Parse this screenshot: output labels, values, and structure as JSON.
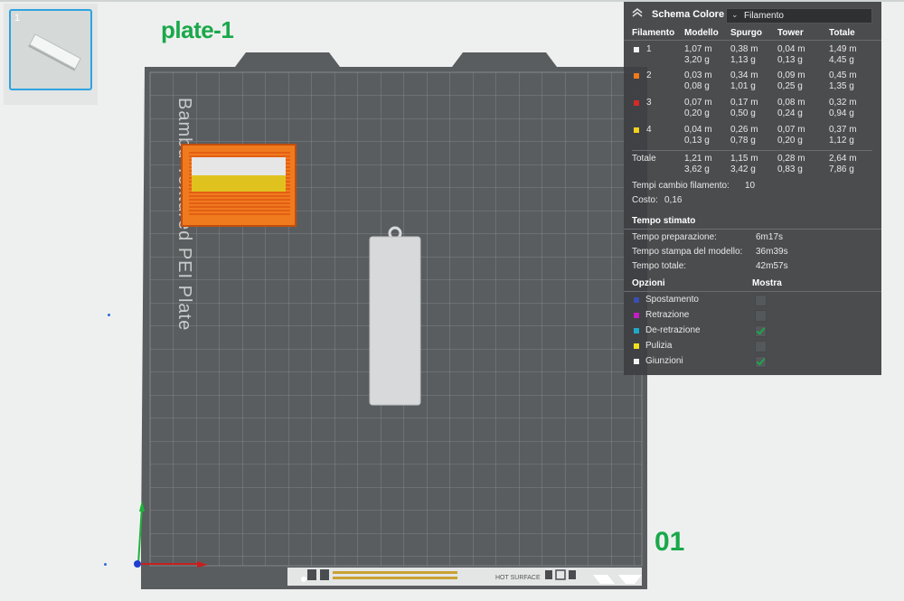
{
  "plate": {
    "label": "plate-1",
    "number_marker": "01",
    "bed_text": "Bambu Textured PEI Plate",
    "hot_surface": "HOT SURFACE"
  },
  "thumbnail": {
    "index": "1"
  },
  "panel": {
    "title": "Schema Colore",
    "dropdown_value": "Filamento",
    "columns": [
      "Filamento",
      "Modello",
      "Spurgo",
      "Tower",
      "Totale"
    ],
    "rows": [
      {
        "id": "1",
        "color": "#f2f2f2",
        "modello": [
          "1,07 m",
          "3,20 g"
        ],
        "spurgo": [
          "0,38 m",
          "1,13 g"
        ],
        "tower": [
          "0,04 m",
          "0,13 g"
        ],
        "totale": [
          "1,49 m",
          "4,45 g"
        ]
      },
      {
        "id": "2",
        "color": "#f27a1a",
        "modello": [
          "0,03 m",
          "0,08 g"
        ],
        "spurgo": [
          "0,34 m",
          "1,01 g"
        ],
        "tower": [
          "0,09 m",
          "0,25 g"
        ],
        "totale": [
          "0,45 m",
          "1,35 g"
        ]
      },
      {
        "id": "3",
        "color": "#d42a2a",
        "modello": [
          "0,07 m",
          "0,20 g"
        ],
        "spurgo": [
          "0,17 m",
          "0,50 g"
        ],
        "tower": [
          "0,08 m",
          "0,24 g"
        ],
        "totale": [
          "0,32 m",
          "0,94 g"
        ]
      },
      {
        "id": "4",
        "color": "#f0d21e",
        "modello": [
          "0,04 m",
          "0,13 g"
        ],
        "spurgo": [
          "0,26 m",
          "0,78 g"
        ],
        "tower": [
          "0,07 m",
          "0,20 g"
        ],
        "totale": [
          "0,37 m",
          "1,12 g"
        ]
      }
    ],
    "total_row": {
      "label": "Totale",
      "modello": [
        "1,21 m",
        "3,62 g"
      ],
      "spurgo": [
        "1,15 m",
        "3,42 g"
      ],
      "tower": [
        "0,28 m",
        "0,83 g"
      ],
      "totale": [
        "2,64 m",
        "7,86 g"
      ]
    },
    "filament_changes": {
      "label": "Tempi cambio filamento:",
      "value": "10"
    },
    "cost": {
      "label": "Costo:",
      "value": "0,16"
    },
    "estimated_time": {
      "title": "Tempo stimato",
      "items": [
        {
          "label": "Tempo preparazione:",
          "value": "6m17s"
        },
        {
          "label": "Tempo stampa del modello:",
          "value": "36m39s"
        },
        {
          "label": "Tempo totale:",
          "value": "42m57s"
        }
      ]
    },
    "options": {
      "title": "Opzioni",
      "show_header": "Mostra",
      "items": [
        {
          "label": "Spostamento",
          "color": "#3a4fb0",
          "checked": false
        },
        {
          "label": "Retrazione",
          "color": "#c21fc2",
          "checked": false
        },
        {
          "label": "De-retrazione",
          "color": "#1fa8c8",
          "checked": true
        },
        {
          "label": "Pulizia",
          "color": "#f0e01e",
          "checked": false
        },
        {
          "label": "Giunzioni",
          "color": "#f2f2f2",
          "checked": true
        }
      ]
    }
  }
}
